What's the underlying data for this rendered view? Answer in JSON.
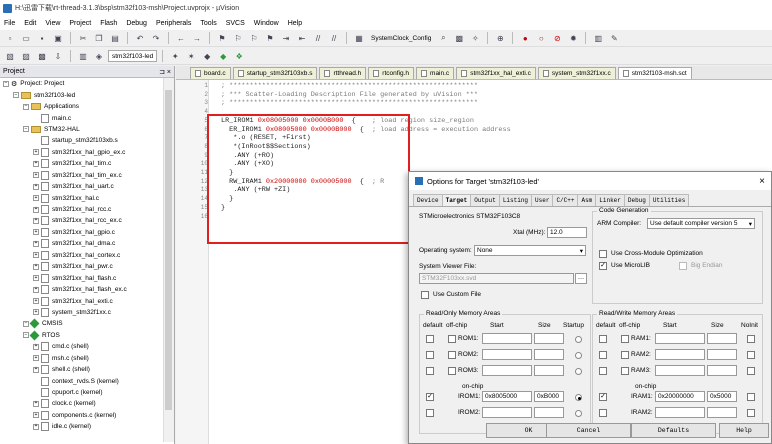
{
  "window": {
    "title": "H:\\迅雷下载\\rt-thread-3.1.3\\bsp\\stm32f103-msh\\Project.uvprojx - µVision"
  },
  "menu": [
    "File",
    "Edit",
    "View",
    "Project",
    "Flash",
    "Debug",
    "Peripherals",
    "Tools",
    "SVCS",
    "Window",
    "Help"
  ],
  "toolbar": {
    "config_label": "SystemClock_Config",
    "target_select": "stm32f103-led"
  },
  "project_panel": {
    "title": "Project",
    "items": [
      {
        "label": "Project: Project",
        "type": "root",
        "indent": 0
      },
      {
        "label": "stm32f103-led",
        "type": "target",
        "indent": 1
      },
      {
        "label": "Applications",
        "type": "folder",
        "indent": 2
      },
      {
        "label": "main.c",
        "type": "file",
        "indent": 3
      },
      {
        "label": "STM32-HAL",
        "type": "folder",
        "indent": 2
      },
      {
        "label": "startup_stm32f103xb.s",
        "type": "file",
        "indent": 3
      },
      {
        "label": "stm32f1xx_hal_gpio_ex.c",
        "type": "file",
        "indent": 3
      },
      {
        "label": "stm32f1xx_hal_tim.c",
        "type": "file",
        "indent": 3
      },
      {
        "label": "stm32f1xx_hal_tim_ex.c",
        "type": "file",
        "indent": 3
      },
      {
        "label": "stm32f1xx_hal_uart.c",
        "type": "file",
        "indent": 3
      },
      {
        "label": "stm32f1xx_hal.c",
        "type": "file",
        "indent": 3
      },
      {
        "label": "stm32f1xx_hal_rcc.c",
        "type": "file",
        "indent": 3
      },
      {
        "label": "stm32f1xx_hal_rcc_ex.c",
        "type": "file",
        "indent": 3
      },
      {
        "label": "stm32f1xx_hal_gpio.c",
        "type": "file",
        "indent": 3
      },
      {
        "label": "stm32f1xx_hal_dma.c",
        "type": "file",
        "indent": 3
      },
      {
        "label": "stm32f1xx_hal_cortex.c",
        "type": "file",
        "indent": 3
      },
      {
        "label": "stm32f1xx_hal_pwr.c",
        "type": "file",
        "indent": 3
      },
      {
        "label": "stm32f1xx_hal_flash.c",
        "type": "file",
        "indent": 3
      },
      {
        "label": "stm32f1xx_hal_flash_ex.c",
        "type": "file",
        "indent": 3
      },
      {
        "label": "stm32f1xx_hal_exti.c",
        "type": "file",
        "indent": 3
      },
      {
        "label": "system_stm32f1xx.c",
        "type": "file",
        "indent": 3
      },
      {
        "label": "CMSIS",
        "type": "gem",
        "indent": 2
      },
      {
        "label": "RTOS",
        "type": "gem",
        "indent": 2
      },
      {
        "label": "cmd.c (shell)",
        "type": "file",
        "indent": 3
      },
      {
        "label": "msh.c (shell)",
        "type": "file",
        "indent": 3
      },
      {
        "label": "shell.c (shell)",
        "type": "file",
        "indent": 3
      },
      {
        "label": "context_rvds.S (kernel)",
        "type": "file",
        "indent": 3
      },
      {
        "label": "cpuport.c (kernel)",
        "type": "file",
        "indent": 3
      },
      {
        "label": "clock.c (kernel)",
        "type": "file",
        "indent": 3
      },
      {
        "label": "components.c (kernel)",
        "type": "file",
        "indent": 3
      },
      {
        "label": "idle.c (kernel)",
        "type": "file",
        "indent": 3
      }
    ]
  },
  "editor_tabs": [
    {
      "label": "board.c",
      "active": false
    },
    {
      "label": "startup_stm32f103xb.s",
      "active": false
    },
    {
      "label": "rtthread.h",
      "active": false
    },
    {
      "label": "rtconfig.h",
      "active": false
    },
    {
      "label": "main.c",
      "active": false
    },
    {
      "label": "stm32f1xx_hal_exti.c",
      "active": false
    },
    {
      "label": "system_stm32f1xx.c",
      "active": false
    },
    {
      "label": "stm32f103-msh.sct",
      "active": true
    }
  ],
  "code_lines": [
    {
      "n": "1",
      "text": "; *************************************************************"
    },
    {
      "n": "2",
      "text": "; *** Scatter-Loading Description File generated by uVision ***"
    },
    {
      "n": "3",
      "text": "; *************************************************************"
    },
    {
      "n": "4",
      "text": ""
    },
    {
      "n": "5",
      "text": "LR_IROM1 0x08005000 0x0000B000  {    ; load region size_region"
    },
    {
      "n": "6",
      "text": "  ER_IROM1 0x08005000 0x0000B000  {  ; load address = execution address"
    },
    {
      "n": "7",
      "text": "   *.o (RESET, +First)"
    },
    {
      "n": "8",
      "text": "   *(InRoot$$Sections)"
    },
    {
      "n": "9",
      "text": "   .ANY (+RO)"
    },
    {
      "n": "10",
      "text": "   .ANY (+XO)"
    },
    {
      "n": "11",
      "text": "  }"
    },
    {
      "n": "12",
      "text": "  RW_IRAM1 0x20000000 0x00005000  {  ; R"
    },
    {
      "n": "13",
      "text": "   .ANY (+RW +ZI)"
    },
    {
      "n": "14",
      "text": "  }"
    },
    {
      "n": "15",
      "text": "}"
    },
    {
      "n": "16",
      "text": ""
    }
  ],
  "dialog": {
    "title": "Options for Target 'stm32f103-led'",
    "close": "×",
    "tabs": [
      "Device",
      "Target",
      "Output",
      "Listing",
      "User",
      "C/C++",
      "Asm",
      "Linker",
      "Debug",
      "Utilities"
    ],
    "active_tab": "Target",
    "device_name": "STMicroelectronics STM32F103C8",
    "xtal_label": "Xtal (MHz):",
    "xtal_value": "12.0",
    "os_label": "Operating system:",
    "os_value": "None",
    "svd_label": "System Viewer File:",
    "svd_value": "STM32F103xx.svd",
    "use_custom_file": "Use Custom File",
    "codegen_title": "Code Generation",
    "arm_compiler_label": "ARM Compiler:",
    "arm_compiler_value": "Use default compiler version 5",
    "cross_module": "Use Cross-Module Optimization",
    "microlib": "Use MicroLIB",
    "big_endian": "Big Endian",
    "ro_title": "Read/Only Memory Areas",
    "rw_title": "Read/Write Memory Areas",
    "col_default": "default",
    "col_offchip": "off-chip",
    "col_start": "Start",
    "col_size": "Size",
    "col_startup": "Startup",
    "col_noinit": "NoInit",
    "on_chip": "on-chip",
    "rom_rows": [
      {
        "name": "ROM1:",
        "start": "",
        "size": "",
        "default": false,
        "startup": false
      },
      {
        "name": "ROM2:",
        "start": "",
        "size": "",
        "default": false,
        "startup": false
      },
      {
        "name": "ROM3:",
        "start": "",
        "size": "",
        "default": false,
        "startup": false
      },
      {
        "name": "IROM1:",
        "start": "0x8005000",
        "size": "0xB000",
        "default": true,
        "startup": true
      },
      {
        "name": "IROM2:",
        "start": "",
        "size": "",
        "default": false,
        "startup": false
      }
    ],
    "ram_rows": [
      {
        "name": "RAM1:",
        "start": "",
        "size": "",
        "default": false
      },
      {
        "name": "RAM2:",
        "start": "",
        "size": "",
        "default": false
      },
      {
        "name": "RAM3:",
        "start": "",
        "size": "",
        "default": false
      },
      {
        "name": "IRAM1:",
        "start": "0x20000000",
        "size": "0x5000",
        "default": true
      },
      {
        "name": "IRAM2:",
        "start": "",
        "size": "",
        "default": false
      }
    ],
    "buttons": {
      "ok": "OK",
      "cancel": "Cancel",
      "defaults": "Defaults",
      "help": "Help"
    }
  },
  "colors": {
    "highlight_box": "#e02020",
    "code_number": "#cc0000",
    "comment": "#7a7a7a"
  }
}
